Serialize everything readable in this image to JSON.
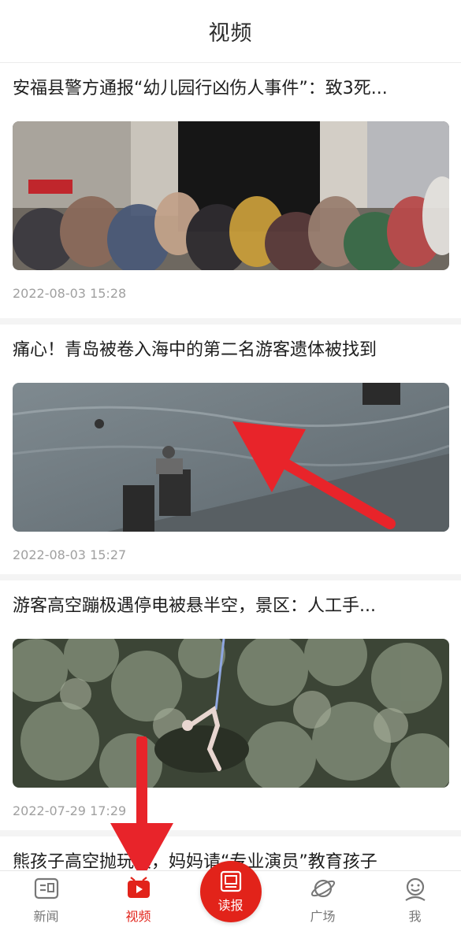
{
  "header": {
    "title": "视频"
  },
  "feed": {
    "items": [
      {
        "title": "安福县警方通报“幼儿园行凶伤人事件”：致3死...",
        "time": "2022-08-03 15:28"
      },
      {
        "title": "痛心！青岛被卷入海中的第二名游客遗体被找到",
        "time": "2022-08-03 15:27"
      },
      {
        "title": "游客高空蹦极遇停电被悬半空，景区：人工手...",
        "time": "2022-07-29 17:29"
      },
      {
        "title": "熊孩子高空抛玩具，妈妈请“专业演员”教育孩子",
        "time": ""
      }
    ]
  },
  "nav": {
    "items": [
      {
        "label": "新闻",
        "icon": "news-icon"
      },
      {
        "label": "视频",
        "icon": "video-icon",
        "active": true
      },
      {
        "label": "读报",
        "icon": "newspaper-icon"
      },
      {
        "label": "广场",
        "icon": "planet-icon"
      },
      {
        "label": "我",
        "icon": "profile-icon"
      }
    ]
  },
  "colors": {
    "accent": "#e2231a",
    "arrow": "#e8242a"
  }
}
